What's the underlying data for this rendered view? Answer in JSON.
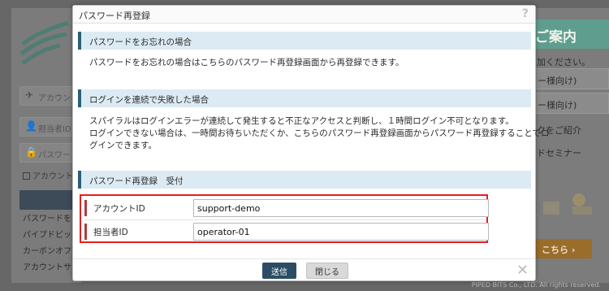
{
  "background": {
    "login": {
      "account_placeholder": "アカウン",
      "staff_placeholder": "担当者ID",
      "password_placeholder": "パスワー",
      "remember_label": "アカウント",
      "links": [
        "パスワードを",
        "パイプドビッ",
        "カーボンオフ",
        "アカウントサ"
      ]
    },
    "guide": {
      "heading": "ご案内",
      "subtext": "加ください。",
      "pill_1": "ー様向け)",
      "pill_2": "ー様向け)",
      "text_1": "クをご紹介",
      "text_2": "ドセミナー",
      "cta_label": "こちら ›"
    },
    "footer": "PIPED BITS Co., LTD. All rights reserved."
  },
  "modal": {
    "title": "パスワード再登録",
    "help_icon": "?",
    "sections": [
      {
        "heading": "パスワードをお忘れの場合",
        "lines": [
          "パスワードをお忘れの場合はこちらのパスワード再登録画面から再登録できます。"
        ]
      },
      {
        "heading": "ログインを連続で失敗した場合",
        "lines": [
          "スパイラルはログインエラーが連続して発生すると不正なアクセスと判断し、１時間ログイン不可となります。",
          "ログインできない場合は、一時間お待ちいただくか、こちらのパスワード再登録画面からパスワード再登録することでロ",
          "グインできます。"
        ]
      },
      {
        "heading": "パスワード再登録　受付"
      }
    ],
    "form": {
      "account_label": "アカウントID",
      "account_value": "support-demo",
      "staff_label": "担当者ID",
      "staff_value": "operator-01"
    },
    "buttons": {
      "submit": "送信",
      "close": "閉じる"
    },
    "close_icon": "✕"
  },
  "colors": {
    "section_head_bg": "#dcebf3",
    "section_head_accent": "#2b5f78",
    "highlight_border": "#e02020",
    "submit_bg": "#2a4d64"
  }
}
